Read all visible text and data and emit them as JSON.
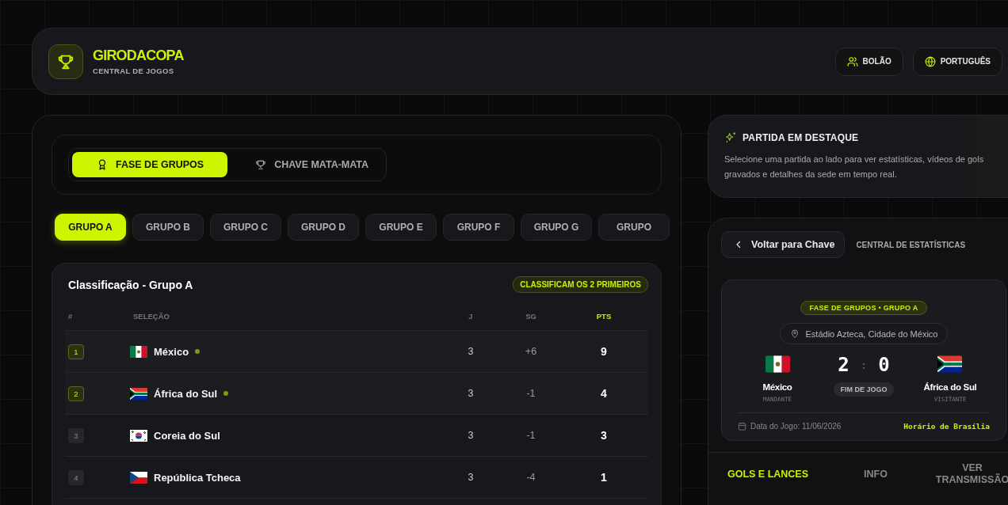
{
  "header": {
    "title": "GIRODACOPA",
    "subtitle": "CENTRAL DE JOGOS",
    "buttons": [
      {
        "label": "BOLÃO",
        "kind": "users"
      },
      {
        "label": "PORTUGUÊS",
        "kind": "globe"
      }
    ]
  },
  "mode_tabs": [
    {
      "label": "FASE DE GRUPOS",
      "selected": true,
      "kind": "award"
    },
    {
      "label": "CHAVE MATA-MATA",
      "selected": false,
      "kind": "trophy"
    }
  ],
  "group_tabs": [
    {
      "label": "GRUPO A",
      "selected": true
    },
    {
      "label": "GRUPO B",
      "selected": false
    },
    {
      "label": "GRUPO C",
      "selected": false
    },
    {
      "label": "GRUPO D",
      "selected": false
    },
    {
      "label": "GRUPO E",
      "selected": false
    },
    {
      "label": "GRUPO F",
      "selected": false
    },
    {
      "label": "GRUPO G",
      "selected": false
    },
    {
      "label": "GRUPO",
      "selected": false
    }
  ],
  "standings": {
    "title": "Classificação - Grupo A",
    "badge": "CLASSIFICAM OS 2 PRIMEIROS",
    "columns": [
      "#",
      "SELEÇÃO",
      "J",
      "SG",
      "PTS"
    ],
    "rows": [
      {
        "rank": "1",
        "team": "México",
        "kind": "mx",
        "qualified": true,
        "played": "3",
        "goal_diff": "+6",
        "points": "9"
      },
      {
        "rank": "2",
        "team": "África do Sul",
        "kind": "za",
        "qualified": true,
        "played": "3",
        "goal_diff": "-1",
        "points": "4"
      },
      {
        "rank": "3",
        "team": "Coreia do Sul",
        "kind": "kr",
        "qualified": false,
        "played": "3",
        "goal_diff": "-1",
        "points": "3"
      },
      {
        "rank": "4",
        "team": "República Tcheca",
        "kind": "cz",
        "qualified": false,
        "played": "3",
        "goal_diff": "-4",
        "points": "1"
      }
    ]
  },
  "featured": {
    "title": "PARTIDA EM DESTAQUE",
    "text": "Selecione uma partida ao lado para ver estatísticas, vídeos de gols gravados e detalhes da sede em tempo real."
  },
  "stats": {
    "back_button": "Voltar para Chave",
    "title": "CENTRAL DE ESTATÍSTICAS",
    "match": {
      "stage": "FASE DE GRUPOS • GRUPO A",
      "venue": "Estádio Azteca, Cidade do México",
      "home": {
        "name": "México",
        "role": "MANDANTE",
        "kind": "mx"
      },
      "away": {
        "name": "África do Sul",
        "role": "VISITANTE",
        "kind": "za"
      },
      "home_score": "2",
      "separator": ":",
      "away_score": "0",
      "status": "FIM DE JOGO",
      "date": "Data do Jogo: 11/06/2026",
      "timezone": "Horário de Brasília"
    },
    "tabs": [
      {
        "label": "GOLS E LANCES",
        "selected": true
      },
      {
        "label": "INFO",
        "selected": false
      },
      {
        "label": "VER TRANSMISSÃO",
        "selected": false
      }
    ]
  }
}
